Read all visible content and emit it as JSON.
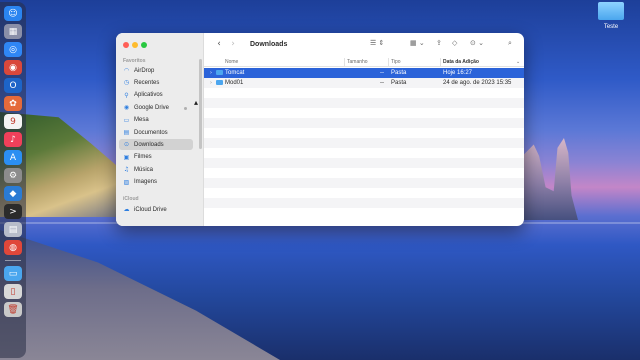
{
  "desktop": {
    "folder_label": "Teste"
  },
  "dock": {
    "icons": [
      {
        "name": "finder-icon",
        "glyph": "☺",
        "color": "#2a84f0"
      },
      {
        "name": "launchpad-icon",
        "glyph": "▦",
        "color": "#8a8fa8"
      },
      {
        "name": "safari-icon",
        "glyph": "◎",
        "color": "#2f86f5"
      },
      {
        "name": "chrome-icon",
        "glyph": "◉",
        "color": "#d9483b"
      },
      {
        "name": "outlook-icon",
        "glyph": "O",
        "color": "#1d64c8"
      },
      {
        "name": "photos-icon",
        "glyph": "✿",
        "color": "#e56a3a"
      },
      {
        "name": "calendar-icon",
        "glyph": "9",
        "color": "#f4f4f4"
      },
      {
        "name": "music-icon",
        "glyph": "♪",
        "color": "#f0405a"
      },
      {
        "name": "app-store-icon",
        "glyph": "A",
        "color": "#2b8ff2"
      },
      {
        "name": "system-settings-icon",
        "glyph": "⚙",
        "color": "#8c8c8c"
      },
      {
        "name": "vscode-icon",
        "glyph": "◆",
        "color": "#2a7bd4"
      },
      {
        "name": "terminal-icon",
        "glyph": ">",
        "color": "#2b2b2b"
      },
      {
        "name": "preview-icon",
        "glyph": "▤",
        "color": "#b7bcc9"
      },
      {
        "name": "activity-icon",
        "glyph": "◍",
        "color": "#e0473a"
      }
    ],
    "extra_icons": [
      {
        "name": "downloads-stack-icon",
        "glyph": "▭",
        "color": "#4aa6ee"
      },
      {
        "name": "document-stack-icon",
        "glyph": "▯",
        "color": "#d8d8d8"
      },
      {
        "name": "trash-icon",
        "glyph": "🗑",
        "color": "#c9c9c9"
      }
    ]
  },
  "finder": {
    "title": "Downloads",
    "sidebar": {
      "favorites_heading": "Favoritos",
      "items": [
        {
          "label": "AirDrop",
          "icon": "airdrop-icon",
          "glyph": "◠"
        },
        {
          "label": "Recentes",
          "icon": "clock-icon",
          "glyph": "◷"
        },
        {
          "label": "Aplicativos",
          "icon": "applications-icon",
          "glyph": "⚲"
        },
        {
          "label": "Google Drive",
          "icon": "google-drive-icon",
          "glyph": "◉"
        },
        {
          "label": "Mesa",
          "icon": "desktop-icon",
          "glyph": "▭"
        },
        {
          "label": "Documentos",
          "icon": "document-icon",
          "glyph": "▤"
        },
        {
          "label": "Downloads",
          "icon": "download-icon",
          "glyph": "⊙"
        },
        {
          "label": "Filmes",
          "icon": "film-icon",
          "glyph": "▣"
        },
        {
          "label": "Música",
          "icon": "music-note-icon",
          "glyph": "♫"
        },
        {
          "label": "Imagens",
          "icon": "photo-icon",
          "glyph": "▨"
        }
      ],
      "icloud_heading": "iCloud",
      "icloud_items": [
        {
          "label": "iCloud Drive",
          "icon": "cloud-icon",
          "glyph": "☁"
        }
      ],
      "selected": "Downloads"
    },
    "columns": {
      "name": "Nome",
      "size": "Tamanho",
      "kind": "Tipo",
      "date_added": "Data da Adição"
    },
    "files": [
      {
        "name": "Tomcat",
        "size": "--",
        "kind": "Pasta",
        "date_added": "Hoje 16:27",
        "selected": true
      },
      {
        "name": "Mod01",
        "size": "--",
        "kind": "Pasta",
        "date_added": "24 de ago. de 2023 15:35",
        "selected": false
      }
    ]
  }
}
